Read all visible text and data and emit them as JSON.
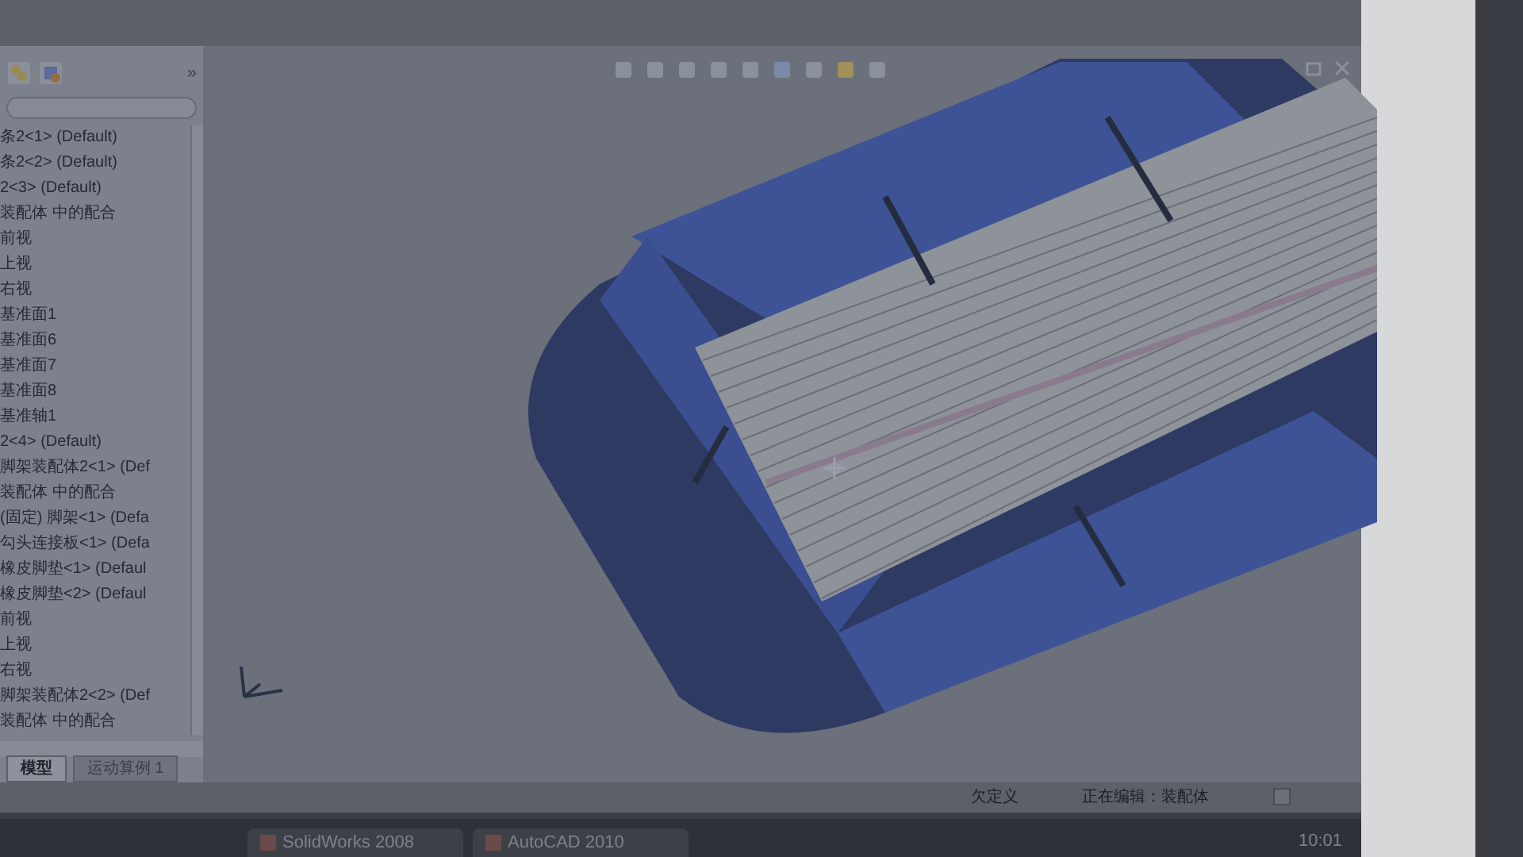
{
  "feature_tree": {
    "toggle": "»",
    "items": [
      {
        "label": "条2<1> (Default)"
      },
      {
        "label": "条2<2> (Default)"
      },
      {
        "label": "2<3> (Default)"
      },
      {
        "label": "装配体 中的配合"
      },
      {
        "label": "前视"
      },
      {
        "label": "上视"
      },
      {
        "label": "右视"
      },
      {
        "label": "基准面1"
      },
      {
        "label": "基准面6"
      },
      {
        "label": "基准面7"
      },
      {
        "label": "基准面8"
      },
      {
        "label": "基准轴1"
      },
      {
        "label": "2<4> (Default)"
      },
      {
        "label": "脚架装配体2<1> (Def"
      },
      {
        "label": "装配体 中的配合"
      },
      {
        "label": "(固定) 脚架<1> (Defa"
      },
      {
        "label": "勾头连接板<1> (Defa"
      },
      {
        "label": "橡皮脚垫<1> (Defaul"
      },
      {
        "label": "橡皮脚垫<2> (Defaul"
      },
      {
        "label": "前视"
      },
      {
        "label": "上视"
      },
      {
        "label": "右视"
      },
      {
        "label": "脚架装配体2<2> (Def"
      },
      {
        "label": "装配体 中的配合"
      }
    ]
  },
  "tabs": [
    {
      "label": "模型",
      "selected": true
    },
    {
      "label": "运动算例 1",
      "selected": false
    }
  ],
  "status_bar": {
    "items": [
      "欠定义",
      "正在编辑：装配体"
    ]
  },
  "taskbar": {
    "buttons": [
      {
        "label": "SolidWorks 2008"
      },
      {
        "label": "AutoCAD 2010"
      }
    ],
    "clock": "10:01"
  }
}
